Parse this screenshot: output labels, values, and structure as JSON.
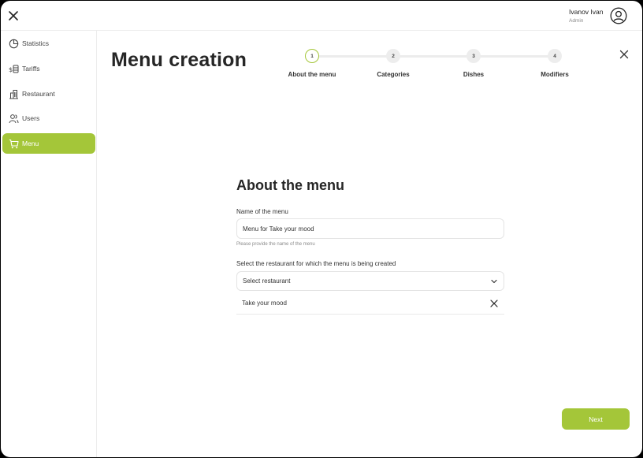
{
  "user": {
    "name": "Ivanov Ivan",
    "role": "Admin"
  },
  "sidebar": {
    "items": [
      {
        "label": "Statistics",
        "icon": "pie-chart-icon",
        "active": false
      },
      {
        "label": "Tariffs",
        "icon": "money-icon",
        "active": false
      },
      {
        "label": "Restaurant",
        "icon": "building-icon",
        "active": false
      },
      {
        "label": "Users",
        "icon": "users-icon",
        "active": false
      },
      {
        "label": "Menu",
        "icon": "cart-icon",
        "active": true
      }
    ]
  },
  "page": {
    "title": "Menu creation"
  },
  "stepper": {
    "current": 1,
    "steps": [
      {
        "number": "1",
        "label": "About the menu"
      },
      {
        "number": "2",
        "label": "Categories"
      },
      {
        "number": "3",
        "label": "Dishes"
      },
      {
        "number": "4",
        "label": "Modifiers"
      }
    ]
  },
  "form": {
    "title": "About the menu",
    "name_label": "Name of the menu",
    "name_value": "Menu for Take your mood",
    "name_hint": "Please provide the name of the menu",
    "restaurant_label": "Select the restaurant for which the menu is being created",
    "restaurant_placeholder": "Select restaurant",
    "selected_restaurants": [
      "Take your mood"
    ]
  },
  "actions": {
    "next_label": "Next"
  },
  "colors": {
    "accent": "#a4c639",
    "text": "#262626",
    "border": "#e4e4e4"
  }
}
